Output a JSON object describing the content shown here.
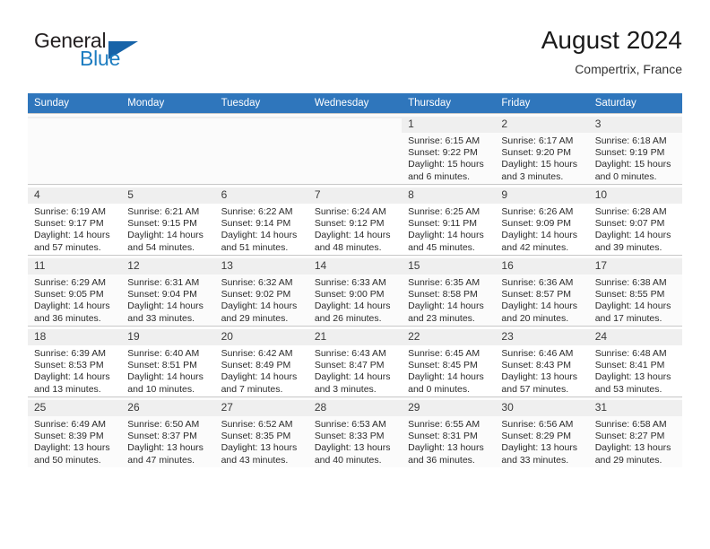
{
  "brand": {
    "name_part1": "General",
    "name_part2": "Blue",
    "triangle_icon": "triangle-icon",
    "color_dark": "#231f20",
    "color_blue": "#1c7cc0"
  },
  "header": {
    "title": "August 2024",
    "location": "Compertrix, France"
  },
  "calendar": {
    "header_bg": "#2f76bc",
    "weekdays": [
      "Sunday",
      "Monday",
      "Tuesday",
      "Wednesday",
      "Thursday",
      "Friday",
      "Saturday"
    ],
    "weeks": [
      [
        {
          "day": "",
          "empty": true,
          "sunrise": "",
          "sunset": "",
          "daylight": ""
        },
        {
          "day": "",
          "empty": true,
          "sunrise": "",
          "sunset": "",
          "daylight": ""
        },
        {
          "day": "",
          "empty": true,
          "sunrise": "",
          "sunset": "",
          "daylight": ""
        },
        {
          "day": "",
          "empty": true,
          "sunrise": "",
          "sunset": "",
          "daylight": ""
        },
        {
          "day": "1",
          "sunrise": "Sunrise: 6:15 AM",
          "sunset": "Sunset: 9:22 PM",
          "daylight": "Daylight: 15 hours and 6 minutes."
        },
        {
          "day": "2",
          "sunrise": "Sunrise: 6:17 AM",
          "sunset": "Sunset: 9:20 PM",
          "daylight": "Daylight: 15 hours and 3 minutes."
        },
        {
          "day": "3",
          "sunrise": "Sunrise: 6:18 AM",
          "sunset": "Sunset: 9:19 PM",
          "daylight": "Daylight: 15 hours and 0 minutes."
        }
      ],
      [
        {
          "day": "4",
          "sunrise": "Sunrise: 6:19 AM",
          "sunset": "Sunset: 9:17 PM",
          "daylight": "Daylight: 14 hours and 57 minutes."
        },
        {
          "day": "5",
          "sunrise": "Sunrise: 6:21 AM",
          "sunset": "Sunset: 9:15 PM",
          "daylight": "Daylight: 14 hours and 54 minutes."
        },
        {
          "day": "6",
          "sunrise": "Sunrise: 6:22 AM",
          "sunset": "Sunset: 9:14 PM",
          "daylight": "Daylight: 14 hours and 51 minutes."
        },
        {
          "day": "7",
          "sunrise": "Sunrise: 6:24 AM",
          "sunset": "Sunset: 9:12 PM",
          "daylight": "Daylight: 14 hours and 48 minutes."
        },
        {
          "day": "8",
          "sunrise": "Sunrise: 6:25 AM",
          "sunset": "Sunset: 9:11 PM",
          "daylight": "Daylight: 14 hours and 45 minutes."
        },
        {
          "day": "9",
          "sunrise": "Sunrise: 6:26 AM",
          "sunset": "Sunset: 9:09 PM",
          "daylight": "Daylight: 14 hours and 42 minutes."
        },
        {
          "day": "10",
          "sunrise": "Sunrise: 6:28 AM",
          "sunset": "Sunset: 9:07 PM",
          "daylight": "Daylight: 14 hours and 39 minutes."
        }
      ],
      [
        {
          "day": "11",
          "sunrise": "Sunrise: 6:29 AM",
          "sunset": "Sunset: 9:05 PM",
          "daylight": "Daylight: 14 hours and 36 minutes."
        },
        {
          "day": "12",
          "sunrise": "Sunrise: 6:31 AM",
          "sunset": "Sunset: 9:04 PM",
          "daylight": "Daylight: 14 hours and 33 minutes."
        },
        {
          "day": "13",
          "sunrise": "Sunrise: 6:32 AM",
          "sunset": "Sunset: 9:02 PM",
          "daylight": "Daylight: 14 hours and 29 minutes."
        },
        {
          "day": "14",
          "sunrise": "Sunrise: 6:33 AM",
          "sunset": "Sunset: 9:00 PM",
          "daylight": "Daylight: 14 hours and 26 minutes."
        },
        {
          "day": "15",
          "sunrise": "Sunrise: 6:35 AM",
          "sunset": "Sunset: 8:58 PM",
          "daylight": "Daylight: 14 hours and 23 minutes."
        },
        {
          "day": "16",
          "sunrise": "Sunrise: 6:36 AM",
          "sunset": "Sunset: 8:57 PM",
          "daylight": "Daylight: 14 hours and 20 minutes."
        },
        {
          "day": "17",
          "sunrise": "Sunrise: 6:38 AM",
          "sunset": "Sunset: 8:55 PM",
          "daylight": "Daylight: 14 hours and 17 minutes."
        }
      ],
      [
        {
          "day": "18",
          "sunrise": "Sunrise: 6:39 AM",
          "sunset": "Sunset: 8:53 PM",
          "daylight": "Daylight: 14 hours and 13 minutes."
        },
        {
          "day": "19",
          "sunrise": "Sunrise: 6:40 AM",
          "sunset": "Sunset: 8:51 PM",
          "daylight": "Daylight: 14 hours and 10 minutes."
        },
        {
          "day": "20",
          "sunrise": "Sunrise: 6:42 AM",
          "sunset": "Sunset: 8:49 PM",
          "daylight": "Daylight: 14 hours and 7 minutes."
        },
        {
          "day": "21",
          "sunrise": "Sunrise: 6:43 AM",
          "sunset": "Sunset: 8:47 PM",
          "daylight": "Daylight: 14 hours and 3 minutes."
        },
        {
          "day": "22",
          "sunrise": "Sunrise: 6:45 AM",
          "sunset": "Sunset: 8:45 PM",
          "daylight": "Daylight: 14 hours and 0 minutes."
        },
        {
          "day": "23",
          "sunrise": "Sunrise: 6:46 AM",
          "sunset": "Sunset: 8:43 PM",
          "daylight": "Daylight: 13 hours and 57 minutes."
        },
        {
          "day": "24",
          "sunrise": "Sunrise: 6:48 AM",
          "sunset": "Sunset: 8:41 PM",
          "daylight": "Daylight: 13 hours and 53 minutes."
        }
      ],
      [
        {
          "day": "25",
          "sunrise": "Sunrise: 6:49 AM",
          "sunset": "Sunset: 8:39 PM",
          "daylight": "Daylight: 13 hours and 50 minutes."
        },
        {
          "day": "26",
          "sunrise": "Sunrise: 6:50 AM",
          "sunset": "Sunset: 8:37 PM",
          "daylight": "Daylight: 13 hours and 47 minutes."
        },
        {
          "day": "27",
          "sunrise": "Sunrise: 6:52 AM",
          "sunset": "Sunset: 8:35 PM",
          "daylight": "Daylight: 13 hours and 43 minutes."
        },
        {
          "day": "28",
          "sunrise": "Sunrise: 6:53 AM",
          "sunset": "Sunset: 8:33 PM",
          "daylight": "Daylight: 13 hours and 40 minutes."
        },
        {
          "day": "29",
          "sunrise": "Sunrise: 6:55 AM",
          "sunset": "Sunset: 8:31 PM",
          "daylight": "Daylight: 13 hours and 36 minutes."
        },
        {
          "day": "30",
          "sunrise": "Sunrise: 6:56 AM",
          "sunset": "Sunset: 8:29 PM",
          "daylight": "Daylight: 13 hours and 33 minutes."
        },
        {
          "day": "31",
          "sunrise": "Sunrise: 6:58 AM",
          "sunset": "Sunset: 8:27 PM",
          "daylight": "Daylight: 13 hours and 29 minutes."
        }
      ]
    ]
  }
}
